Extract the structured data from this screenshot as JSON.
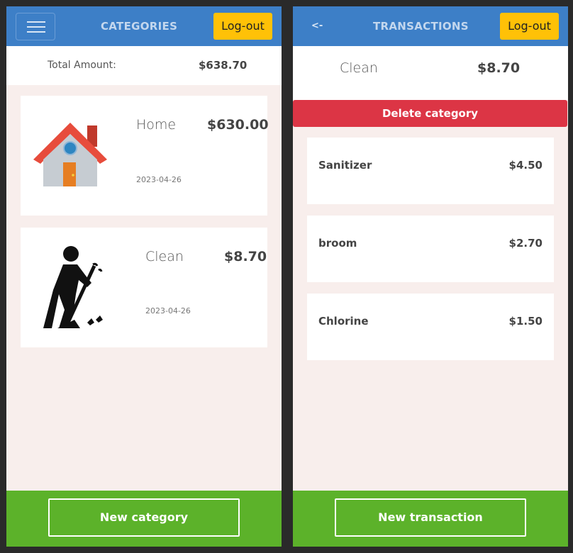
{
  "categories_screen": {
    "title": "CATEGORIES",
    "logout_label": "Log-out",
    "total_label": "Total Amount:",
    "total_value": "$638.70",
    "items": [
      {
        "name": "Home",
        "amount": "$630.00",
        "date": "2023-04-26",
        "icon": "house-icon"
      },
      {
        "name": "Clean",
        "amount": "$8.70",
        "date": "2023-04-26",
        "icon": "cleaning-person-icon"
      }
    ],
    "new_button_label": "New category"
  },
  "transactions_screen": {
    "back_label": "<-",
    "title": "TRANSACTIONS",
    "logout_label": "Log-out",
    "category_name": "Clean",
    "category_total": "$8.70",
    "delete_label": "Delete category",
    "transactions": [
      {
        "name": "Sanitizer",
        "amount": "$4.50"
      },
      {
        "name": "broom",
        "amount": "$2.70"
      },
      {
        "name": "Chlorine",
        "amount": "$1.50"
      }
    ],
    "new_button_label": "New transaction"
  },
  "colors": {
    "header": "#3d7fc7",
    "logout": "#ffc107",
    "footer": "#5cb22a",
    "delete": "#dc3545",
    "background": "#f8eeec"
  }
}
